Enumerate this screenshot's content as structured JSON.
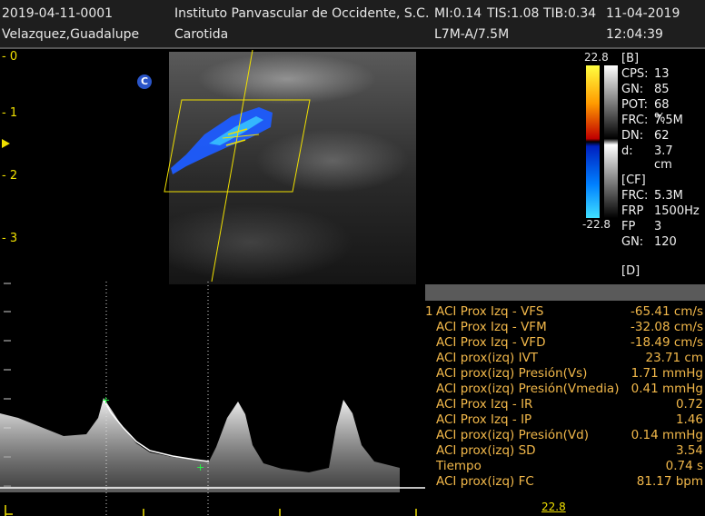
{
  "header": {
    "exam_id": "2019-04-11-0001",
    "institution": "Instituto Panvascular de Occidente, S.C.",
    "mi": "MI:0.14",
    "tis": "TIS:1.08",
    "tib": "TIB:0.34",
    "date": "11-04-2019",
    "patient": "Velazquez,Guadalupe",
    "study": "Carotida",
    "probe": "L7M-A/7.5M",
    "time": "12:04:39"
  },
  "depth_scale": [
    "0",
    "1",
    "2",
    "3"
  ],
  "marker_label": "C",
  "color_bar": {
    "top": "22.8",
    "bottom": "-22.8"
  },
  "b_params": {
    "title": "[B]",
    "rows": [
      {
        "k": "CPS:",
        "v": "13"
      },
      {
        "k": "GN:",
        "v": "85"
      },
      {
        "k": "POT:",
        "v": "68 %"
      },
      {
        "k": "FRC:",
        "v": "7.5M"
      },
      {
        "k": "DN:",
        "v": "62"
      },
      {
        "k": "d:",
        "v": "3.7 cm"
      }
    ]
  },
  "cf_params": {
    "title": "[CF]",
    "rows": [
      {
        "k": "FRC:",
        "v": "5.3M"
      },
      {
        "k": "FRP",
        "v": "1500Hz"
      },
      {
        "k": "FP",
        "v": "3"
      },
      {
        "k": "GN:",
        "v": "120"
      }
    ]
  },
  "d_params": {
    "title": "[D]"
  },
  "measurements": [
    {
      "idx": "1",
      "label": "ACI Prox Izq - VFS",
      "value": "-65.41 cm/s"
    },
    {
      "idx": "",
      "label": "ACI Prox Izq - VFM",
      "value": "-32.08 cm/s"
    },
    {
      "idx": "",
      "label": "ACI Prox Izq - VFD",
      "value": "-18.49 cm/s"
    },
    {
      "idx": "",
      "label": "ACI prox(izq) IVT",
      "value": "23.71 cm"
    },
    {
      "idx": "",
      "label": "ACI prox(izq) Presión(Vs)",
      "value": "1.71 mmHg"
    },
    {
      "idx": "",
      "label": "ACI prox(izq) Presión(Vmedia)",
      "value": "0.41 mmHg"
    },
    {
      "idx": "",
      "label": "ACI Prox Izq - IR",
      "value": "0.72"
    },
    {
      "idx": "",
      "label": "ACI Prox Izq - IP",
      "value": "1.46"
    },
    {
      "idx": "",
      "label": "ACI prox(izq) Presión(Vd)",
      "value": "0.14 mmHg"
    },
    {
      "idx": "",
      "label": "ACI prox(izq) SD",
      "value": "3.54"
    },
    {
      "idx": "",
      "label": "Tiempo",
      "value": "0.74 s"
    },
    {
      "idx": "",
      "label": "ACI prox(izq) FC",
      "value": "81.17 bpm"
    }
  ],
  "spectral_scale_label": "22.8",
  "colors": {
    "accent_yellow": "#f0e000",
    "measurement_text": "#f2b84a",
    "flow_blue": "#1e5cff"
  }
}
